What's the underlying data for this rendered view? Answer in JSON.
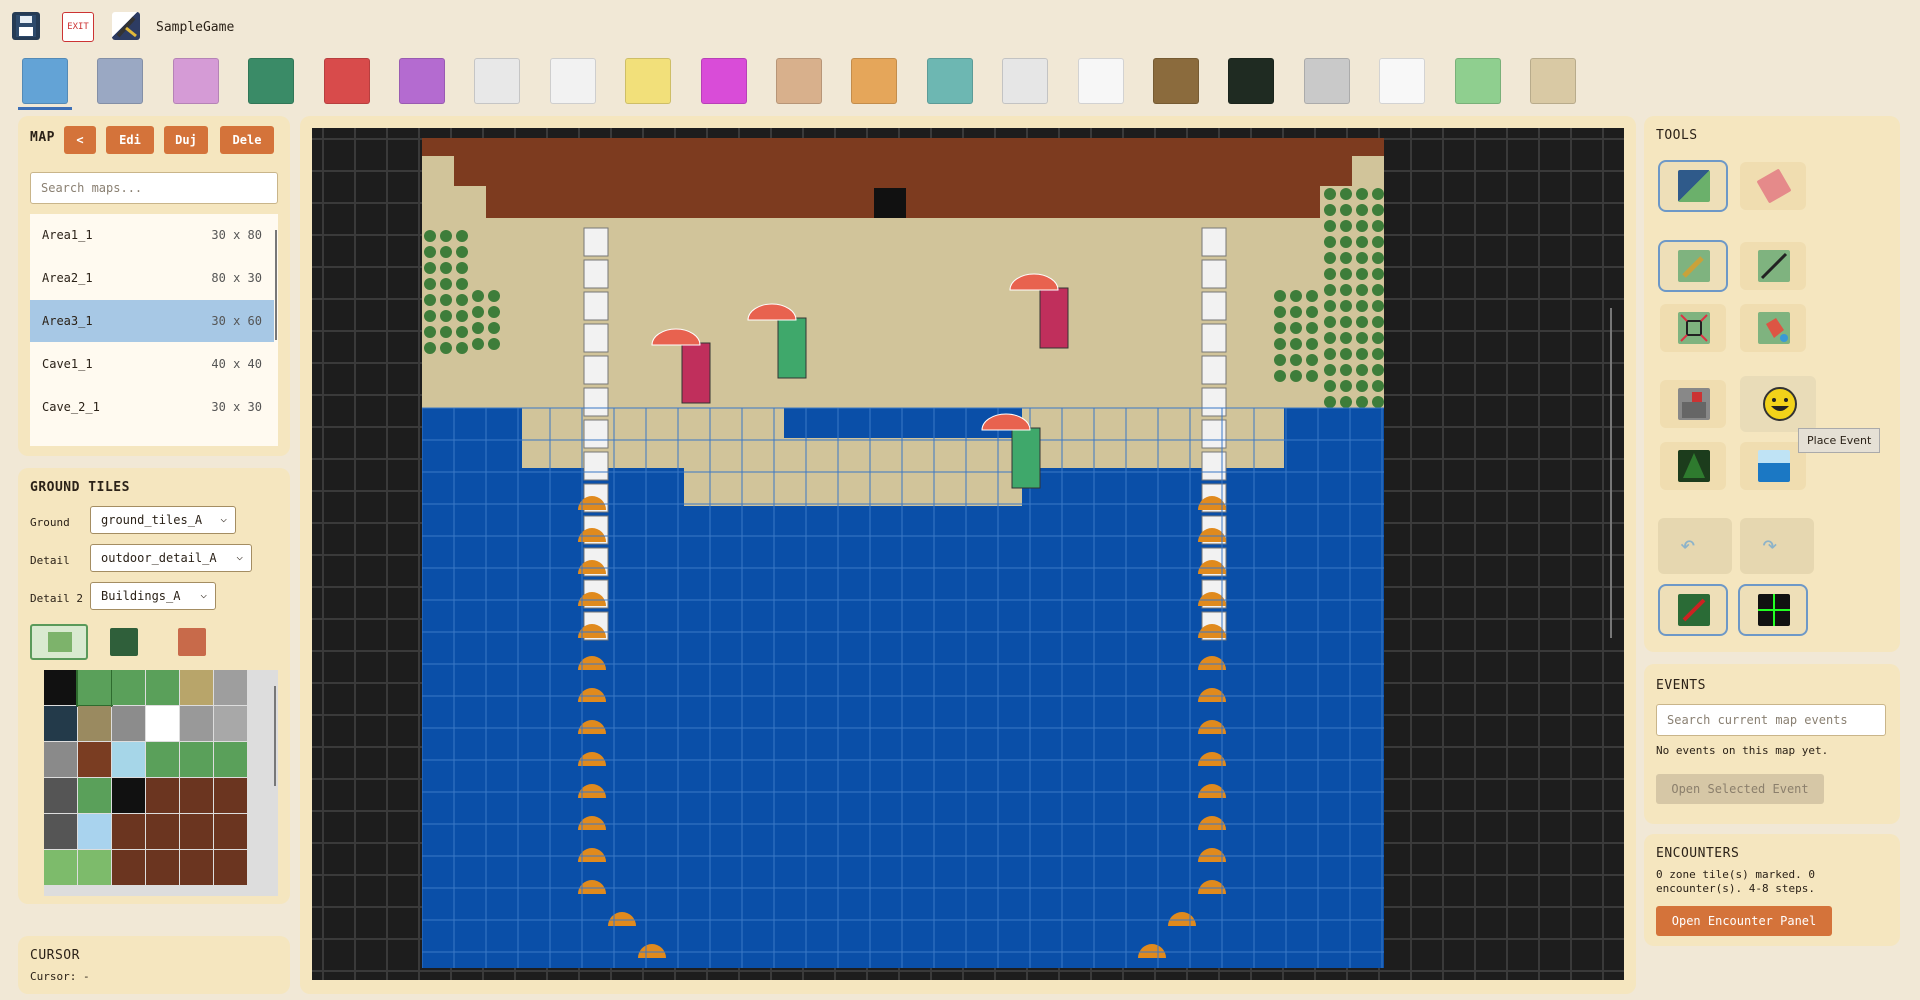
{
  "header": {
    "project_name": "SampleGame",
    "save_icon": "save-icon",
    "exit_label": "EXIT",
    "game_icon": "game-icon"
  },
  "toolbar": {
    "tools": [
      {
        "name": "map-editor-icon",
        "color": "#63a3d6"
      },
      {
        "name": "tileset-icon",
        "color": "#9aa8c3"
      },
      {
        "name": "egg-icon",
        "color": "#d59bd6"
      },
      {
        "name": "play-icon",
        "color": "#3a8b67"
      },
      {
        "name": "vs-icon",
        "color": "#d84b4b"
      },
      {
        "name": "fire-icon",
        "color": "#b46bd0"
      },
      {
        "name": "running-icon",
        "color": "#e8e8e8"
      },
      {
        "name": "id-card-icon",
        "color": "#f2f2f2"
      },
      {
        "name": "potion-icon",
        "color": "#f2e07a"
      },
      {
        "name": "monster-icon",
        "color": "#d94cd8"
      },
      {
        "name": "characters-icon",
        "color": "#d8b08c"
      },
      {
        "name": "tools-icon",
        "color": "#e5a65a"
      },
      {
        "name": "shop-icon",
        "color": "#6db7b2"
      },
      {
        "name": "script-icon",
        "color": "#e6e6e6"
      },
      {
        "name": "music-icon",
        "color": "#f7f7f7"
      },
      {
        "name": "mona-lisa-icon",
        "color": "#8b6b3d"
      },
      {
        "name": "variables-icon",
        "color": "#1f2b22"
      },
      {
        "name": "window-icon",
        "color": "#c9c9c9"
      },
      {
        "name": "text-icon",
        "color": "#f8f8f8"
      },
      {
        "name": "dragon-icon",
        "color": "#8fcf8f"
      },
      {
        "name": "palette-icon",
        "color": "#d9c9a4"
      }
    ]
  },
  "maps_panel": {
    "title": "MAP",
    "buttons": [
      "<",
      "Edi",
      "Duj",
      "Dele"
    ],
    "search_placeholder": "Search maps...",
    "items": [
      {
        "name": "Area1_1",
        "size": "30 x 80"
      },
      {
        "name": "Area2_1",
        "size": "80 x 30"
      },
      {
        "name": "Area3_1",
        "size": "30 x 60"
      },
      {
        "name": "Cave1_1",
        "size": "40 x 40"
      },
      {
        "name": "Cave_2_1",
        "size": "30 x 30"
      }
    ]
  },
  "ground_tiles": {
    "title": "GROUND TILES",
    "rows": [
      {
        "label": "Ground",
        "value": "ground_tiles_A"
      },
      {
        "label": "Detail",
        "value": "outdoor_detail_A"
      },
      {
        "label": "Detail 2",
        "value": "Buildings_A"
      }
    ],
    "tab_icons": [
      "layer-ground-icon",
      "layer-detail-icon",
      "layer-npc-icon"
    ]
  },
  "cursor": {
    "title": "CURSOR",
    "text": "Cursor: -"
  },
  "tools": {
    "title": "TOOLS",
    "tooltip": "Place Event"
  },
  "events": {
    "title": "EVENTS",
    "search_placeholder": "Search current map events",
    "empty_text": "No events on this map yet.",
    "open_button": "Open Selected Event"
  },
  "encounters": {
    "title": "ENCOUNTERS",
    "summary_line1": "0 zone tile(s) marked. 0",
    "summary_line2": "encounter(s). 4-8 steps.",
    "open_button": "Open Encounter Panel"
  },
  "colors": {
    "accent": "#d4733a",
    "selected": "#a7c8e5",
    "water": "#0a4fa8",
    "sand": "#d1c49a",
    "wall": "#7d3b1f"
  }
}
